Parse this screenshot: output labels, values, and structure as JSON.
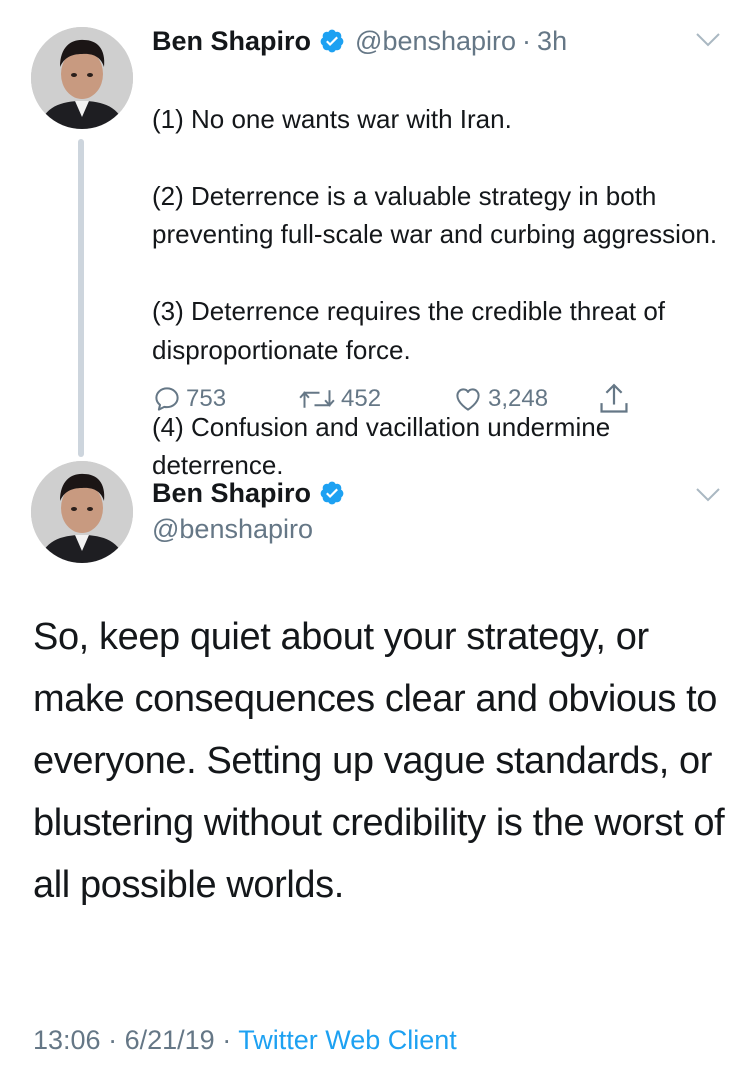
{
  "tweet1": {
    "display_name": "Ben Shapiro",
    "handle": "@benshapiro",
    "separator": "·",
    "time": "3h",
    "lines": [
      "(1) No one wants war with Iran.",
      "(2) Deterrence is a valuable strategy in both preventing full-scale war and curbing aggression.",
      "(3) Deterrence requires the credible threat of disproportionate force.",
      "(4) Confusion and vacillation undermine deterrence."
    ],
    "replies": "753",
    "retweets": "452",
    "likes": "3,248"
  },
  "tweet2": {
    "display_name": "Ben Shapiro",
    "handle": "@benshapiro",
    "text": "So, keep quiet about your strategy, or make consequences clear and obvious to everyone. Setting up vague standards, or blustering without credibility is the worst of all possible worlds.",
    "time": "13:06",
    "separator1": "·",
    "date": "6/21/19",
    "separator2": "·",
    "client": "Twitter Web Client"
  },
  "icons": {
    "verified": "verified-badge-icon",
    "chevron": "chevron-down-icon",
    "reply": "reply-icon",
    "retweet": "retweet-icon",
    "like": "heart-icon",
    "share": "share-icon"
  },
  "colors": {
    "text": "#14171a",
    "secondary": "#657786",
    "link": "#1da1f2",
    "thread_line": "#cdd5dd"
  }
}
